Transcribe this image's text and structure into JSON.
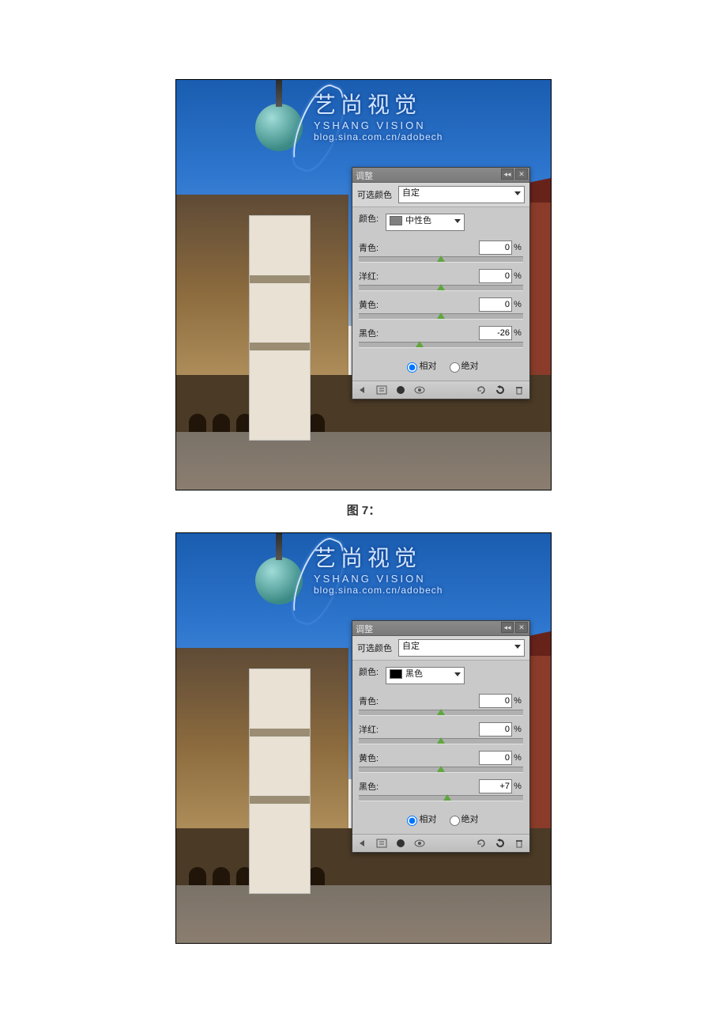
{
  "caption_between": "图 7：",
  "watermark": {
    "cn": "艺尚视觉",
    "en": "YSHANG VISION",
    "url": "blog.sina.com.cn/adobech"
  },
  "panel_common": {
    "title": "调整",
    "row_panel_label": "可选颜色",
    "preset_value": "自定",
    "color_label": "颜色:",
    "cyan_label": "青色:",
    "magenta_label": "洋红:",
    "yellow_label": "黄色:",
    "black_label": "黑色:",
    "percent": "%",
    "radio_relative": "相对",
    "radio_absolute": "绝对"
  },
  "figures": [
    {
      "color_swatch": "#808080",
      "color_name": "中性色",
      "values": {
        "cyan": "0",
        "magenta": "0",
        "yellow": "0",
        "black": "-26"
      },
      "black_thumb_pct": 37
    },
    {
      "color_swatch": "#000000",
      "color_name": "黑色",
      "values": {
        "cyan": "0",
        "magenta": "0",
        "yellow": "0",
        "black": "+7"
      },
      "black_thumb_pct": 54
    }
  ]
}
